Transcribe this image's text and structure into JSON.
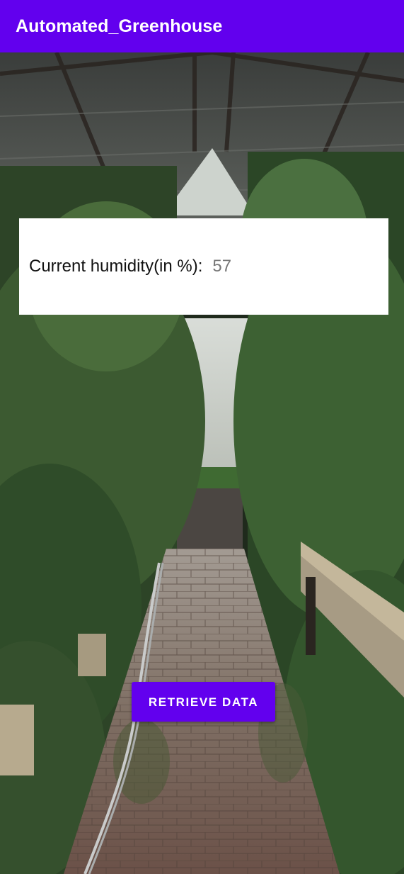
{
  "app_bar": {
    "title": "Automated_Greenhouse",
    "color": "#6200ee"
  },
  "background": {
    "description_icon": "greenhouse-photo"
  },
  "humidity_card": {
    "label": "Current humidity(in %):",
    "value": "57"
  },
  "retrieve_button": {
    "label": "RETRIEVE DATA",
    "color": "#6200ee"
  }
}
